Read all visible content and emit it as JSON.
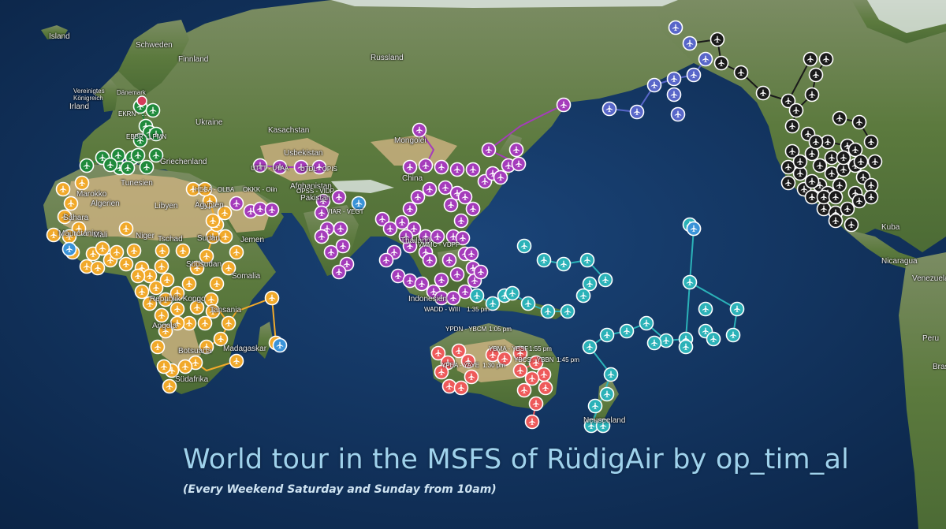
{
  "map": {
    "title": "World tour in the MSFS of RüdigAir by op_tim_al",
    "subtitle": "(Every Weekend Saturday and Sunday from 10am)",
    "colors": {
      "ocean": "#11345f",
      "land": "#5f7d44",
      "desert": "#c9b07f",
      "europe": "#1f8a3b",
      "africa": "#f1a92a",
      "asia": "#a53cbb",
      "oceania": "#2bb2b8",
      "australia": "#ee5a5a",
      "alaska": "#5866c9",
      "northamerica": "#1a1a1a",
      "special": "#3a93d8",
      "marker": "#d43b5a"
    },
    "place_labels": [
      "Island",
      "Schweden",
      "Finnland",
      "Russland",
      "Vereinigtes Königreich",
      "Irland",
      "Dänemark",
      "Ukraine",
      "Kasachstan",
      "Mongolei",
      "Griechenland",
      "Tunesien",
      "Marokko",
      "Algerien",
      "Libyen",
      "Ägypten",
      "Usbekistan",
      "Afghanistan",
      "Pakistan",
      "Jemen",
      "Sahara",
      "Mauretanien",
      "Mali",
      "Niger",
      "Tschad",
      "Sudan",
      "Südsudan",
      "Somalia",
      "Republik Kongo",
      "Tansania",
      "Angola",
      "Botsuana",
      "Madagaskar",
      "Südafrika",
      "China",
      "Thailand",
      "Indonesien",
      "Kuba",
      "Nicaragua",
      "Venezuela",
      "Peru",
      "Brasilien",
      "Neuseeland"
    ],
    "route_labels": [
      "EKRN - ...",
      "EBBR - LPMN",
      "HECA - OLBA",
      "OKKK - Oiin",
      "UTTT - UTAA",
      "UTDL - OPIS",
      "OPSS - VIDP",
      "VIAR - VEGT",
      "VMMC - VDPP",
      "WADD - WIII",
      "YPDN - YBCM",
      "YBMA - YBSF",
      "YBCS - YBBN",
      "YPEA - YAYE"
    ],
    "route_times": [
      "1:35 pm",
      "1:05 pm",
      "1:55 pm",
      "1:45 pm",
      "1:30 pm"
    ]
  }
}
